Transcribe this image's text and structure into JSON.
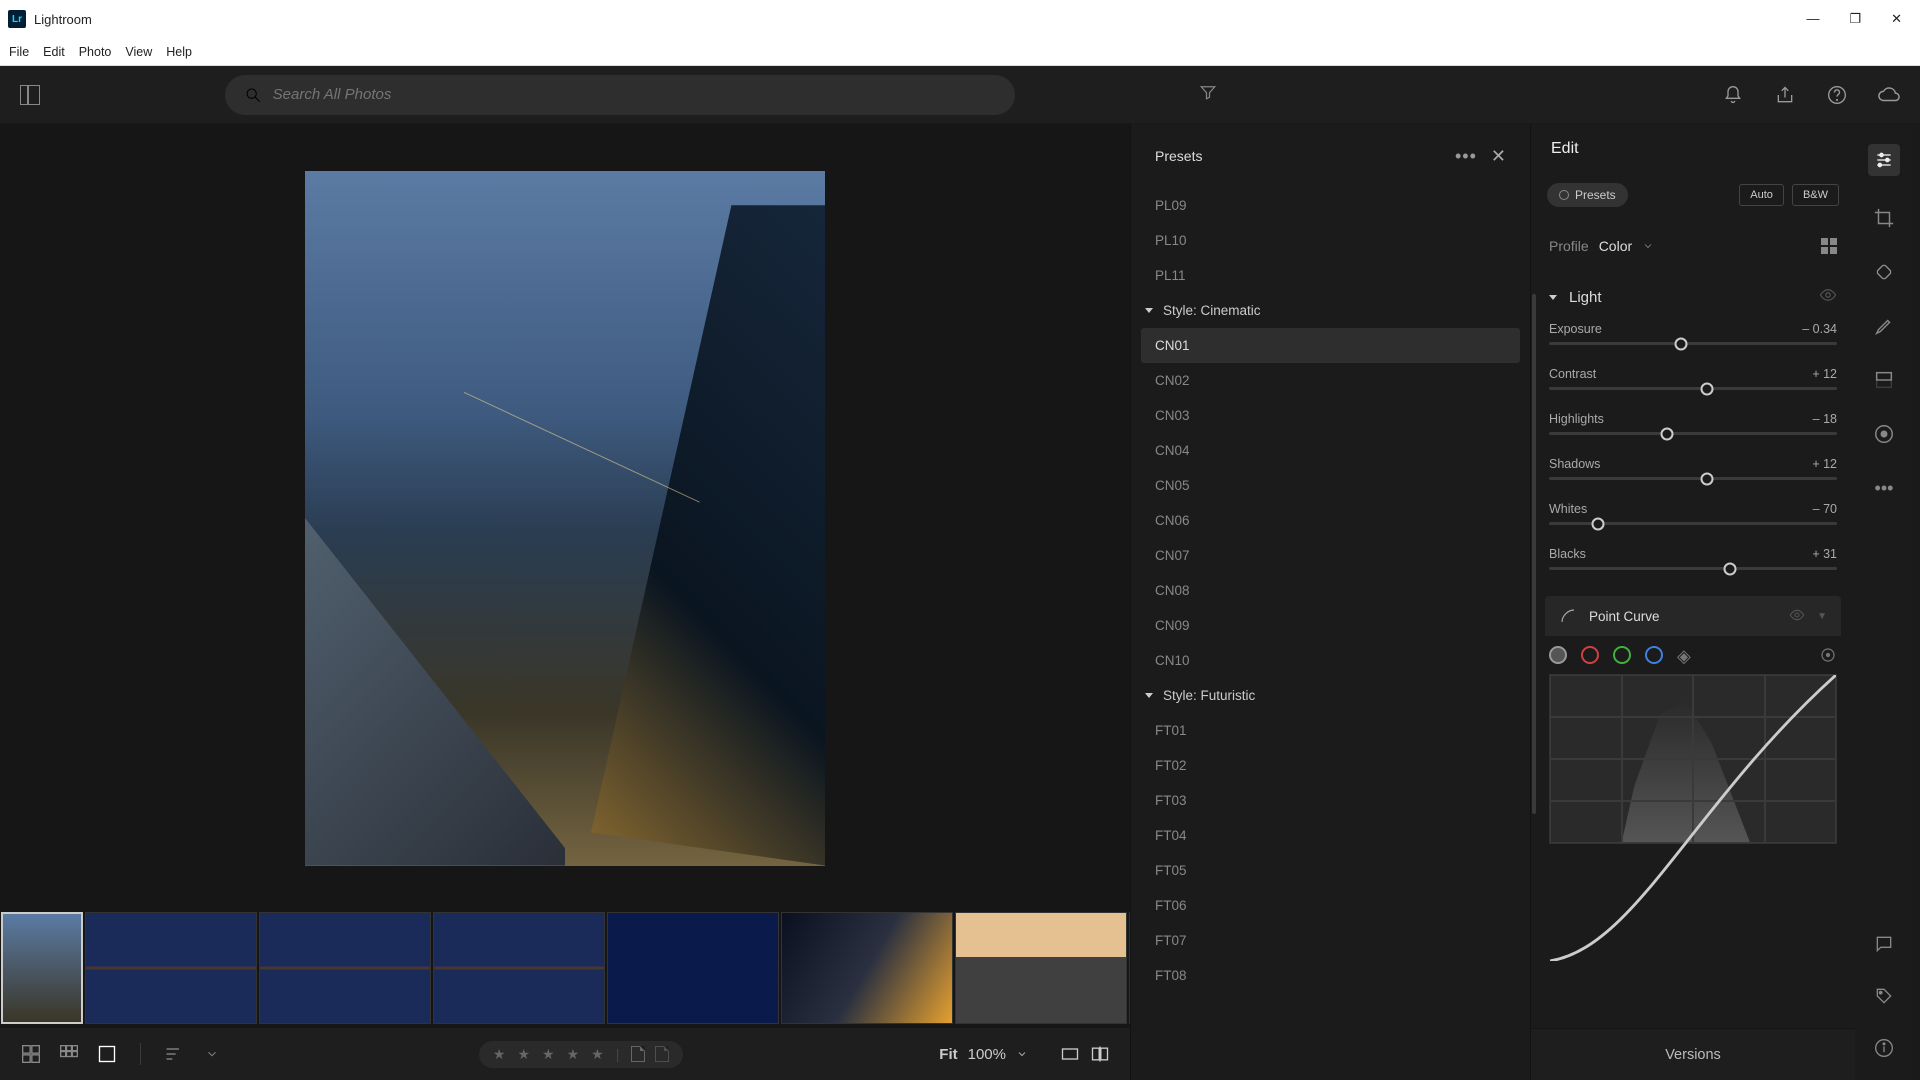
{
  "app": {
    "title": "Lightroom",
    "logo_text": "Lr"
  },
  "menubar": [
    "File",
    "Edit",
    "Photo",
    "View",
    "Help"
  ],
  "toolbar": {
    "search_placeholder": "Search All Photos"
  },
  "presets_panel": {
    "title": "Presets",
    "items": [
      {
        "type": "item",
        "label": "PL09"
      },
      {
        "type": "item",
        "label": "PL10"
      },
      {
        "type": "item",
        "label": "PL11"
      },
      {
        "type": "group",
        "label": "Style: Cinematic"
      },
      {
        "type": "item",
        "label": "CN01",
        "selected": true
      },
      {
        "type": "item",
        "label": "CN02"
      },
      {
        "type": "item",
        "label": "CN03"
      },
      {
        "type": "item",
        "label": "CN04"
      },
      {
        "type": "item",
        "label": "CN05"
      },
      {
        "type": "item",
        "label": "CN06"
      },
      {
        "type": "item",
        "label": "CN07"
      },
      {
        "type": "item",
        "label": "CN08"
      },
      {
        "type": "item",
        "label": "CN09"
      },
      {
        "type": "item",
        "label": "CN10"
      },
      {
        "type": "group",
        "label": "Style: Futuristic"
      },
      {
        "type": "item",
        "label": "FT01"
      },
      {
        "type": "item",
        "label": "FT02"
      },
      {
        "type": "item",
        "label": "FT03"
      },
      {
        "type": "item",
        "label": "FT04"
      },
      {
        "type": "item",
        "label": "FT05"
      },
      {
        "type": "item",
        "label": "FT06"
      },
      {
        "type": "item",
        "label": "FT07"
      },
      {
        "type": "item",
        "label": "FT08"
      }
    ]
  },
  "edit_panel": {
    "title": "Edit",
    "presets_btn": "Presets",
    "auto_btn": "Auto",
    "bw_btn": "B&W",
    "profile_label": "Profile",
    "profile_value": "Color",
    "light_section": "Light",
    "sliders": [
      {
        "label": "Exposure",
        "value": "– 0.34",
        "pos": 46
      },
      {
        "label": "Contrast",
        "value": "+ 12",
        "pos": 55
      },
      {
        "label": "Highlights",
        "value": "– 18",
        "pos": 41
      },
      {
        "label": "Shadows",
        "value": "+ 12",
        "pos": 55
      },
      {
        "label": "Whites",
        "value": "– 70",
        "pos": 17
      },
      {
        "label": "Blacks",
        "value": "+ 31",
        "pos": 63
      }
    ],
    "point_curve": "Point Curve",
    "versions": "Versions"
  },
  "zoom": {
    "fit": "Fit",
    "level": "100%"
  }
}
